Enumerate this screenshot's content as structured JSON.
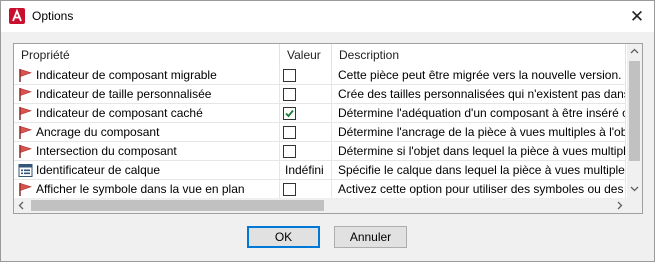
{
  "window": {
    "title": "Options"
  },
  "grid": {
    "headers": {
      "property": "Propriété",
      "value": "Valeur",
      "description": "Description"
    },
    "rows": [
      {
        "property": "Indicateur de composant migrable",
        "icon": "red-flag-icon",
        "checked": false,
        "value_text": "",
        "description": "Cette pièce peut être migrée vers la nouvelle version."
      },
      {
        "property": "Indicateur de taille personnalisée",
        "icon": "red-flag-icon",
        "checked": false,
        "value_text": "",
        "description": "Crée des tailles personnalisées qui n'existent pas dans la"
      },
      {
        "property": "Indicateur de composant caché",
        "icon": "red-flag-icon",
        "checked": true,
        "value_text": "",
        "description": "Détermine l'adéquation d'un composant à être inséré ou"
      },
      {
        "property": "Ancrage du composant",
        "icon": "red-flag-icon",
        "checked": false,
        "value_text": "",
        "description": "Détermine l'ancrage de la pièce à vues multiples à l'objet"
      },
      {
        "property": "Intersection du composant",
        "icon": "red-flag-icon",
        "checked": false,
        "value_text": "",
        "description": "Détermine si l'objet dans lequel la pièce à vues multiples"
      },
      {
        "property": "Identificateur de calque",
        "icon": "layer-list-icon",
        "checked": null,
        "value_text": "Indéfini",
        "description": "Spécifie le calque dans lequel la pièce à vues multiples"
      },
      {
        "property": "Afficher le symbole dans la vue en plan",
        "icon": "red-flag-icon",
        "checked": false,
        "value_text": "",
        "description": "Activez cette option pour utiliser des symboles ou des"
      }
    ]
  },
  "buttons": {
    "ok": "OK",
    "cancel": "Annuler"
  },
  "colors": {
    "accent": "#0078d7",
    "flag": "#d9534f",
    "check": "#1a7f37"
  }
}
